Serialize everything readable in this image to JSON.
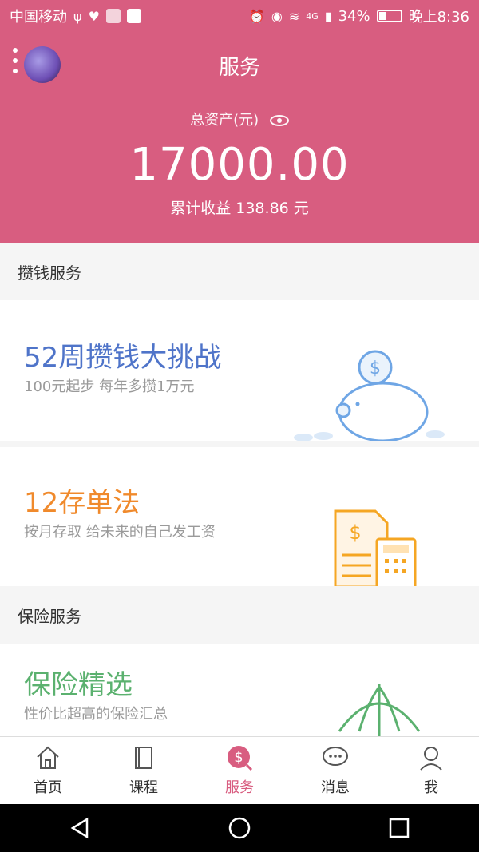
{
  "status": {
    "carrier": "中国移动",
    "signal_label": "4G",
    "battery": "34%",
    "time": "晚上8:36"
  },
  "header": {
    "title": "服务",
    "asset_label": "总资产(元)",
    "asset_value": "17000.00",
    "earnings": "累计收益 138.86 元"
  },
  "sections": {
    "save": "攒钱服务",
    "insurance": "保险服务"
  },
  "cards": [
    {
      "title": "52周攒钱大挑战",
      "subtitle": "100元起步   每年多攒1万元",
      "color": "#4f74c9"
    },
    {
      "title": "12存单法",
      "subtitle": "按月存取   给未来的自己发工资",
      "color": "#f08a2c"
    },
    {
      "title": "保险精选",
      "subtitle": "性价比超高的保险汇总",
      "color": "#5bb16f"
    }
  ],
  "nav": [
    {
      "label": "首页",
      "icon": "home-icon"
    },
    {
      "label": "课程",
      "icon": "book-icon"
    },
    {
      "label": "服务",
      "icon": "service-icon"
    },
    {
      "label": "消息",
      "icon": "message-icon"
    },
    {
      "label": "我",
      "icon": "profile-icon"
    }
  ],
  "colors": {
    "accent": "#d85d80"
  }
}
